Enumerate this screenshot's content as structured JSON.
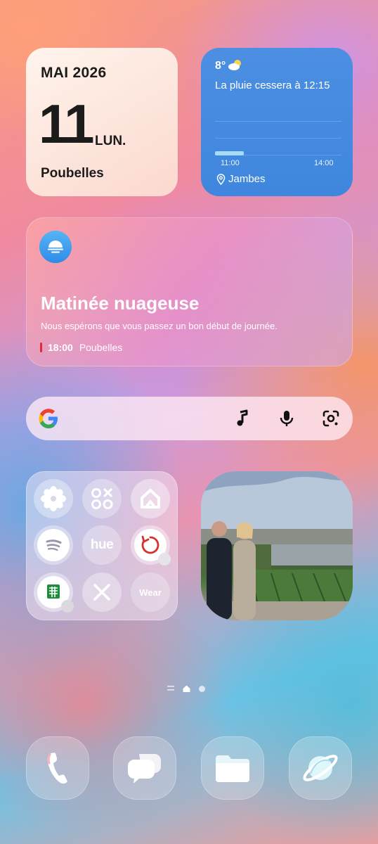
{
  "calendar": {
    "month_year": "MAI 2026",
    "day": "11",
    "weekday": "LUN.",
    "event": "Poubelles"
  },
  "weather": {
    "temperature": "8°",
    "condition_icon": "partly-cloudy-icon",
    "rain_message": "La pluie cessera à 12:15",
    "time_start": "11:00",
    "time_end": "14:00",
    "location": "Jambes"
  },
  "briefing": {
    "icon": "cloud-dawn-icon",
    "title": "Matinée nuageuse",
    "subtitle": "Nous espérons que vous passez un bon début de journée.",
    "event_time": "18:00",
    "event_name": "Poubelles",
    "event_color": "#e0283a"
  },
  "search": {
    "icons": [
      "google-logo",
      "music-note-icon",
      "microphone-icon",
      "google-lens-icon"
    ]
  },
  "folder": {
    "apps": [
      {
        "name": "flower-app-icon"
      },
      {
        "name": "game-launcher-icon"
      },
      {
        "name": "smartthings-icon"
      },
      {
        "name": "spotify-icon"
      },
      {
        "name": "hue-icon",
        "label": "hue"
      },
      {
        "name": "refresh-app-icon"
      },
      {
        "name": "sheets-icon"
      },
      {
        "name": "x-icon"
      },
      {
        "name": "wear-icon",
        "label": "Wear"
      }
    ]
  },
  "dock": {
    "apps": [
      "phone-icon",
      "messages-icon",
      "files-icon",
      "internet-icon"
    ]
  },
  "colors": {
    "weather_bg": "#3f86de",
    "accent_red": "#e0283a"
  }
}
